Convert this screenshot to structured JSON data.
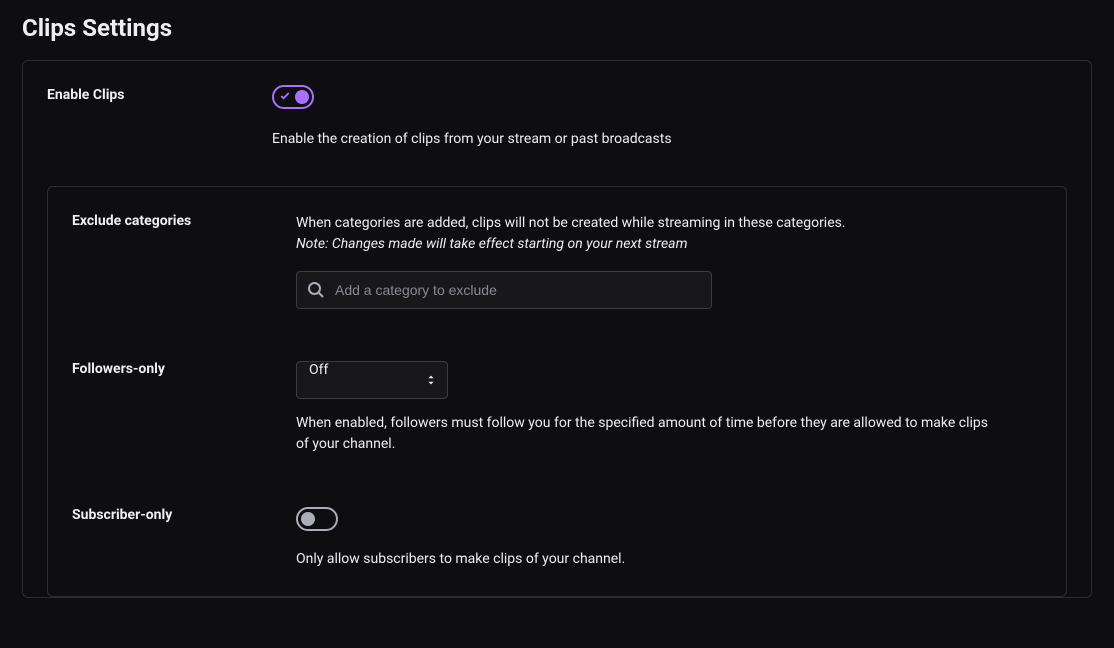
{
  "page": {
    "title": "Clips Settings"
  },
  "enable_clips": {
    "label": "Enable Clips",
    "enabled": true,
    "description": "Enable the creation of clips from your stream or past broadcasts"
  },
  "exclude_categories": {
    "label": "Exclude categories",
    "help": "When categories are added, clips will not be created while streaming in these categories.",
    "note": "Note: Changes made will take effect starting on your next stream",
    "placeholder": "Add a category to exclude",
    "value": ""
  },
  "followers_only": {
    "label": "Followers-only",
    "selected": "Off",
    "description": "When enabled, followers must follow you for the specified amount of time before they are allowed to make clips of your channel."
  },
  "subscriber_only": {
    "label": "Subscriber-only",
    "enabled": false,
    "description": "Only allow subscribers to make clips of your channel."
  }
}
